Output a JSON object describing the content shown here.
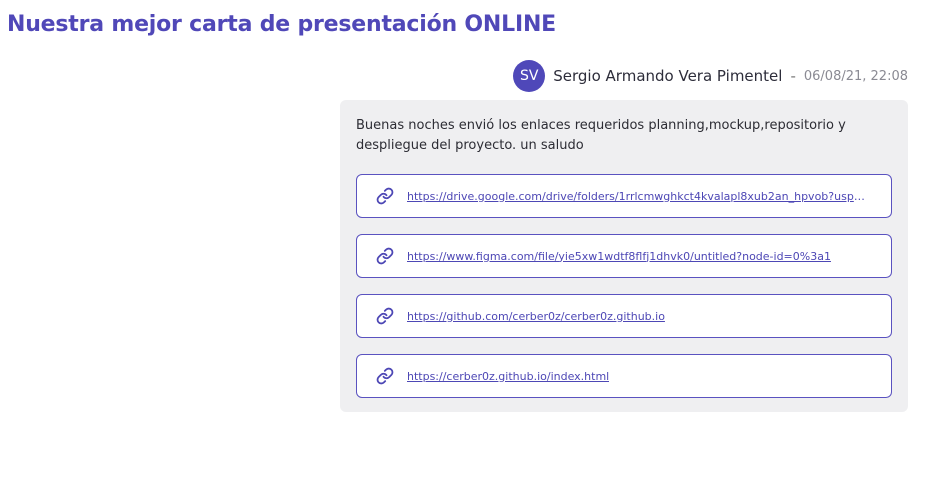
{
  "header": {
    "title": "Nuestra mejor carta de presentación ONLINE"
  },
  "post": {
    "avatar_initials": "SV",
    "author": "Sergio Armando Vera Pimentel",
    "separator": "-",
    "timestamp": "06/08/21, 22:08",
    "message": "Buenas noches envió los enlaces requeridos planning,mockup,repositorio y despliegue del proyecto. un saludo",
    "links": [
      {
        "icon": "link-icon",
        "text": "https://drive.google.com/drive/folders/1rrlcmwghkct4kvalapl8xub2an_hpvob?usp=s..."
      },
      {
        "icon": "link-icon",
        "text": "https://www.figma.com/file/yie5xw1wdtf8flfj1dhvk0/untitled?node-id=0%3a1"
      },
      {
        "icon": "link-icon",
        "text": "https://github.com/cerber0z/cerber0z.github.io"
      },
      {
        "icon": "link-icon",
        "text": "https://cerber0z.github.io/index.html"
      }
    ]
  },
  "colors": {
    "accent": "#5048b8",
    "bubble_bg": "#efeff1"
  }
}
